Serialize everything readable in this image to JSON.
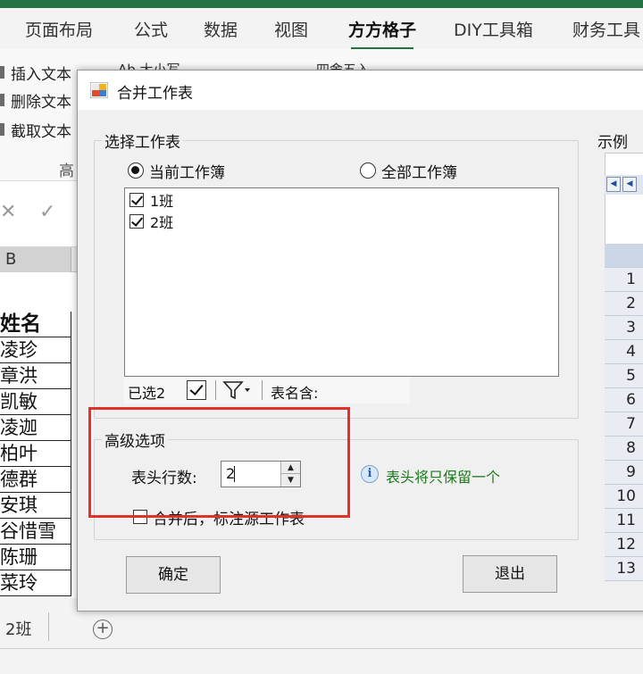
{
  "ribbon": {
    "tabs": [
      "页面布局",
      "公式",
      "数据",
      "视图",
      "方方格子",
      "DIY工具箱",
      "财务工具"
    ],
    "active_tab": "方方格子",
    "left_items": [
      "插入文本",
      "删除文本",
      "截取文本"
    ],
    "group_label": "高",
    "fragments": [
      "Ab 大小写",
      "四舍五入"
    ]
  },
  "sheet": {
    "column": "B",
    "cells": [
      "姓名",
      "凌珍",
      "章洪",
      "凯敏",
      "凌迦",
      "柏叶",
      "德群",
      "安琪",
      "谷惜雪",
      "陈珊",
      "菜玲"
    ],
    "tab_label": "2班",
    "add_sheet_symbol": "+"
  },
  "dialog": {
    "title": "合并工作表",
    "select_group": {
      "legend": "选择工作表",
      "radio_current": "当前工作簿",
      "radio_all": "全部工作簿",
      "selected": "current",
      "sheets": [
        {
          "name": "1班",
          "checked": true
        },
        {
          "name": "2班",
          "checked": true
        }
      ],
      "selected_count_label": "已选2",
      "filter_label": "表名含:"
    },
    "advanced_group": {
      "legend": "高级选项",
      "header_rows_label": "表头行数:",
      "header_rows_value": "2",
      "info_text": "表头将只保留一个",
      "annotate_label": "合并后，标注源工作表",
      "annotate_checked": false
    },
    "example": {
      "legend": "示例",
      "rows": [
        "1",
        "2",
        "3",
        "4",
        "5",
        "6",
        "7",
        "8",
        "9",
        "10",
        "11",
        "12",
        "13"
      ]
    },
    "ok_label": "确定",
    "exit_label": "退出"
  },
  "colors": {
    "excel_green": "#217346",
    "highlight_red": "#e0322a",
    "info_green": "#1a7a1a"
  }
}
